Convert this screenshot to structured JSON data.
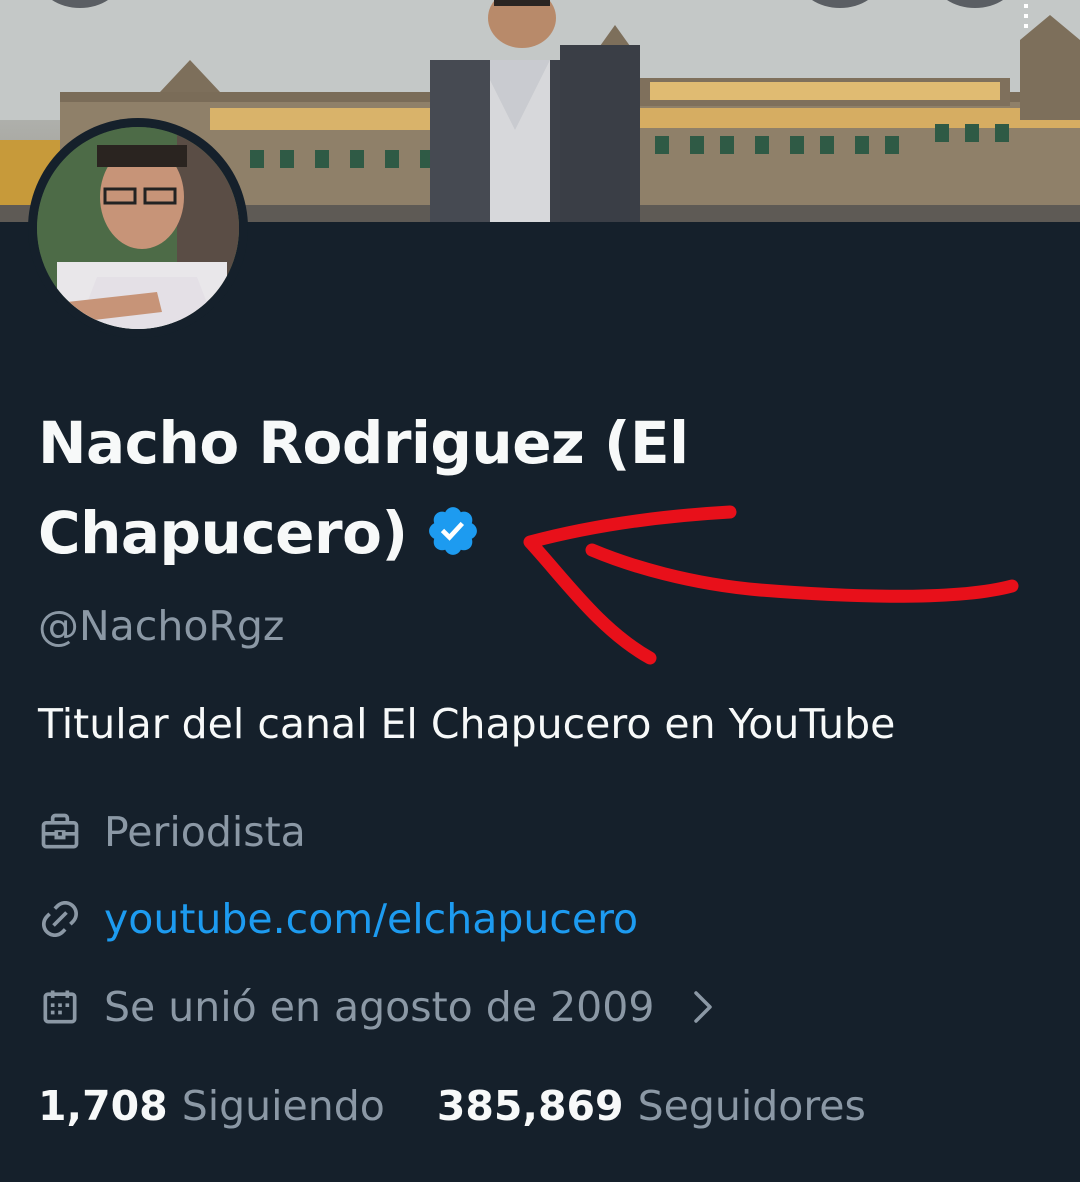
{
  "profile": {
    "display_name": "Nacho Rodriguez (El Chapucero)",
    "handle": "@NachoRgz",
    "bio": "Titular del canal El Chapucero en YouTube",
    "profession": "Periodista",
    "website": "youtube.com/elchapucero",
    "joined": "Se unió en agosto de 2009"
  },
  "stats": {
    "following_count": "1,708",
    "following_label": "Siguiendo",
    "followers_count": "385,869",
    "followers_label": "Seguidores"
  },
  "icons": {
    "verified": "verified-badge-icon",
    "profession": "briefcase-icon",
    "website": "link-icon",
    "joined": "calendar-icon",
    "more": "chevron-right-icon"
  },
  "colors": {
    "background": "#15202b",
    "accent": "#1d9bf0",
    "secondary_text": "#8b98a5",
    "annotation": "#e8101a"
  }
}
